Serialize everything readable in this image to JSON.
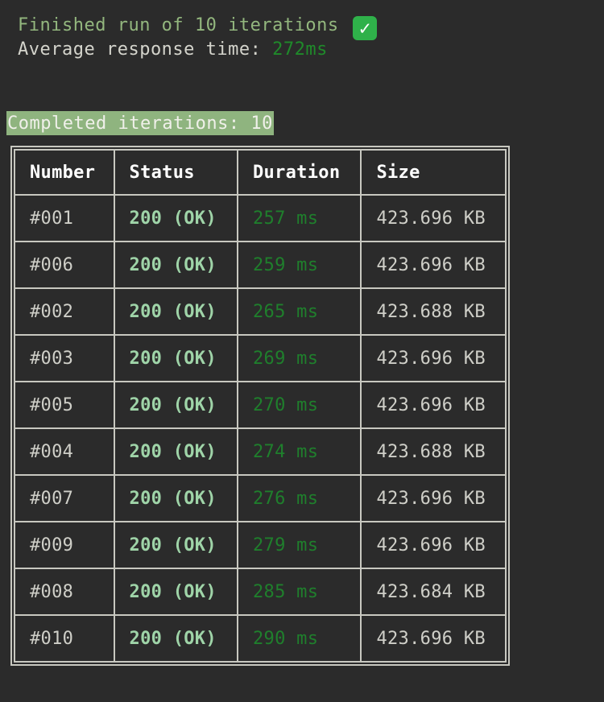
{
  "summary": {
    "finished_text": "Finished run of 10 iterations",
    "finished_icon": "check-mark-button-icon",
    "average_label": "Average response time: ",
    "average_value": "272ms"
  },
  "completed_badge": "Completed iterations: 10",
  "colors": {
    "finished_text": "#93b77e",
    "average_value": "#1f8a2a",
    "badge_background": "#8fb47f",
    "status_text": "#9fd4a8",
    "duration_text": "#1f7f2c",
    "background": "#2b2b2b"
  },
  "table": {
    "headers": [
      "Number",
      "Status",
      "Duration",
      "Size"
    ],
    "rows": [
      {
        "number": "#001",
        "status": "200 (OK)",
        "duration": "257 ms",
        "size": "423.696 KB"
      },
      {
        "number": "#006",
        "status": "200 (OK)",
        "duration": "259 ms",
        "size": "423.696 KB"
      },
      {
        "number": "#002",
        "status": "200 (OK)",
        "duration": "265 ms",
        "size": "423.688 KB"
      },
      {
        "number": "#003",
        "status": "200 (OK)",
        "duration": "269 ms",
        "size": "423.696 KB"
      },
      {
        "number": "#005",
        "status": "200 (OK)",
        "duration": "270 ms",
        "size": "423.696 KB"
      },
      {
        "number": "#004",
        "status": "200 (OK)",
        "duration": "274 ms",
        "size": "423.688 KB"
      },
      {
        "number": "#007",
        "status": "200 (OK)",
        "duration": "276 ms",
        "size": "423.696 KB"
      },
      {
        "number": "#009",
        "status": "200 (OK)",
        "duration": "279 ms",
        "size": "423.696 KB"
      },
      {
        "number": "#008",
        "status": "200 (OK)",
        "duration": "285 ms",
        "size": "423.684 KB"
      },
      {
        "number": "#010",
        "status": "200 (OK)",
        "duration": "290 ms",
        "size": "423.696 KB"
      }
    ]
  }
}
